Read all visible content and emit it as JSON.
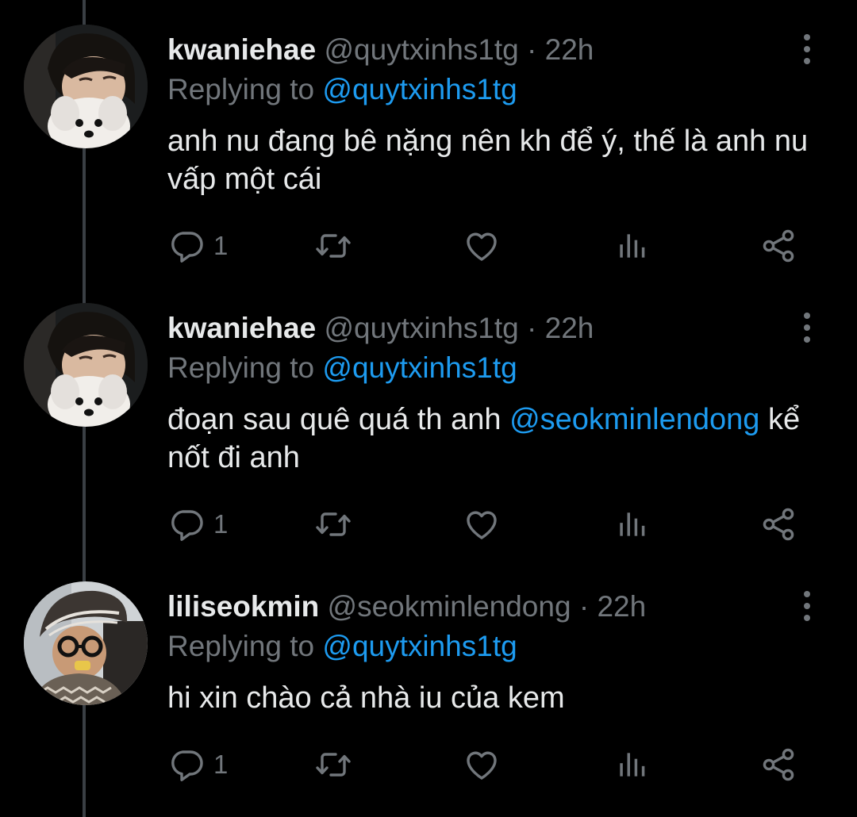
{
  "colors": {
    "background": "#000000",
    "text": "#e7e9ea",
    "secondary": "#71767b",
    "link": "#1d9bf0",
    "thread_line": "#3a3f44"
  },
  "tweets": [
    {
      "display_name": "kwaniehae",
      "handle": "@quytxinhs1tg",
      "separator": "·",
      "time": "22h",
      "replying_prefix": "Replying to",
      "replying_handle": "@quytxinhs1tg",
      "text": "anh nu đang bê nặng nên kh để ý, thế là anh nu vấp một cái",
      "reply_count": "1",
      "avatar_icon": "avatar-man-with-white-dog"
    },
    {
      "display_name": "kwaniehae",
      "handle": "@quytxinhs1tg",
      "separator": "·",
      "time": "22h",
      "replying_prefix": "Replying to",
      "replying_handle": "@quytxinhs1tg",
      "text_before": "đoạn sau quê quá th anh",
      "mention": "@seokminlendong",
      "text_after": "kể nốt đi anh",
      "reply_count": "1",
      "avatar_icon": "avatar-man-with-white-dog"
    },
    {
      "display_name": "liliseokmin",
      "handle": "@seokminlendong",
      "separator": "·",
      "time": "22h",
      "replying_prefix": "Replying to",
      "replying_handle": "@quytxinhs1tg",
      "text": "hi xin chào cả nhà iu của kem",
      "reply_count": "1",
      "avatar_icon": "avatar-person-with-glasses-and-bucket-hat"
    }
  ],
  "action_icons": [
    "reply-icon",
    "retweet-icon",
    "like-icon",
    "views-icon",
    "share-icon"
  ]
}
